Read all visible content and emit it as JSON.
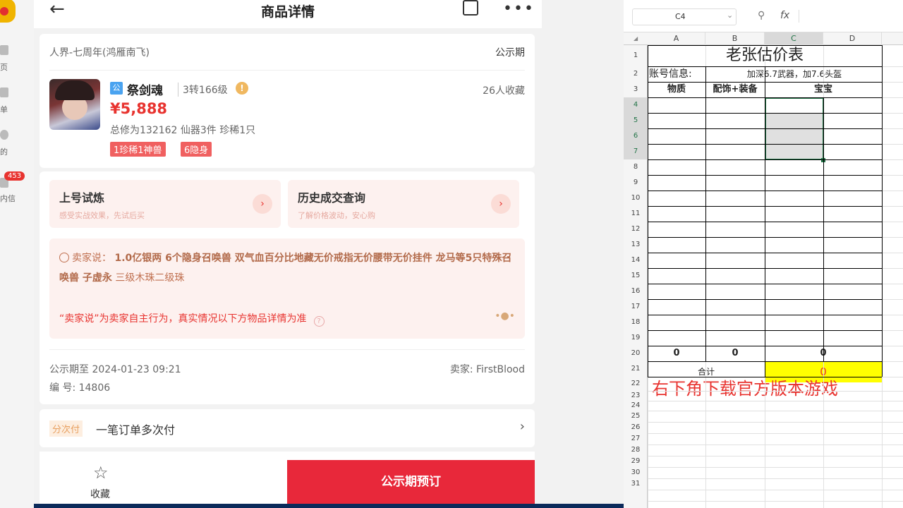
{
  "sidebar": {
    "items": [
      {
        "label": "首页",
        "visible": "页"
      },
      {
        "label": "订单",
        "visible": "单"
      },
      {
        "label": "我的",
        "visible": "的"
      },
      {
        "label": "站内信",
        "visible": "内信"
      }
    ],
    "badge": "453"
  },
  "header": {
    "title": "商品详情"
  },
  "product": {
    "server": "人界-七周年(鸿雁南飞)",
    "status": "公示期",
    "official_tag": "公",
    "name": "祭剑魂",
    "level": "3转166级",
    "favorites": "26人收藏",
    "price": "¥5,888",
    "stats": "总修为132162  仙器3件  珍稀1只",
    "tags": [
      "1珍稀1神兽",
      "6隐身"
    ]
  },
  "promos": [
    {
      "title": "上号试炼",
      "subtitle": "感受实战效果，先试后买"
    },
    {
      "title": "历史成交查询",
      "subtitle": "了解价格波动，安心购"
    }
  ],
  "seller_says": {
    "label": "卖家说：",
    "bold_text": "1.0亿银两 6个隐身召唤兽 双气血百分比地藏无价戒指无价腰带无价挂件 龙马等5只特殊召唤兽 子虚永",
    "normal_text": "三级木珠二级珠",
    "disclaimer": "“卖家说”为卖家自主行为，真实情况以下方物品详情为准"
  },
  "meta": {
    "publish_time": "公示期至 2024-01-23 09:21",
    "seller": "卖家: FirstBlood",
    "serial": "编 号: 14806"
  },
  "installment": {
    "tag": "分次付",
    "text": "一笔订单多次付"
  },
  "bottom": {
    "favorite_label": "收藏",
    "reserve_label": "公示期预订"
  },
  "spreadsheet": {
    "name_box": "C4",
    "columns": [
      "A",
      "B",
      "C",
      "D"
    ],
    "rows": [
      "1",
      "2",
      "3",
      "4",
      "5",
      "6",
      "7",
      "8",
      "9",
      "10",
      "11",
      "12",
      "13",
      "14",
      "15",
      "16",
      "17",
      "18",
      "19",
      "20",
      "21",
      "22",
      "23",
      "24",
      "25",
      "26",
      "27",
      "28",
      "29",
      "30",
      "31"
    ],
    "title": "老张估价表",
    "info_label": "账号信息:",
    "info_value": "加深6.7武器，加7.6头盔",
    "headers": [
      "物质",
      "配饰+装备",
      "宝宝"
    ],
    "totals": [
      "0",
      "0",
      "0"
    ],
    "sum_label": "合计",
    "sum_value": "0",
    "red_note": "右下角下载官方版本游戏",
    "colors": {
      "selection": "#217346",
      "sum_fill": "#ffff00",
      "red": "#e8332f"
    }
  }
}
